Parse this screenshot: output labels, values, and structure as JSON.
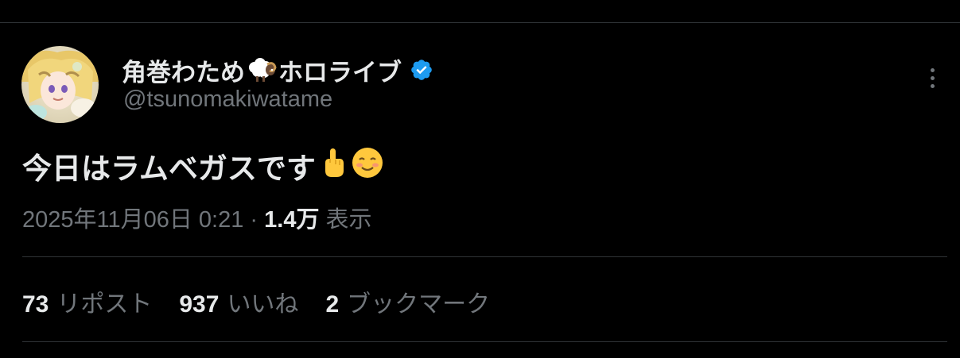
{
  "author": {
    "display_name_part1": "角巻わため",
    "display_name_emoji": "sheep-icon",
    "display_name_part2": "ホロライブ",
    "verified_icon": "verified-badge-icon",
    "handle": "@tsunomakiwatame"
  },
  "tweet": {
    "text": "今日はラムベガスです",
    "emojis": [
      "pointing-up-emoji",
      "smiling-face-emoji"
    ]
  },
  "meta": {
    "timestamp": "2025年11月06日 0:21",
    "separator": " · ",
    "views_count": "1.4万",
    "views_label": "表示"
  },
  "stats": {
    "reposts_count": "73",
    "reposts_label": "リポスト",
    "likes_count": "937",
    "likes_label": "いいね",
    "bookmarks_count": "2",
    "bookmarks_label": "ブックマーク"
  },
  "colors": {
    "background": "#000000",
    "text_primary": "#e7e9ea",
    "text_secondary": "#71767b",
    "divider": "#2f3336",
    "verified_blue": "#1d9bf0"
  }
}
